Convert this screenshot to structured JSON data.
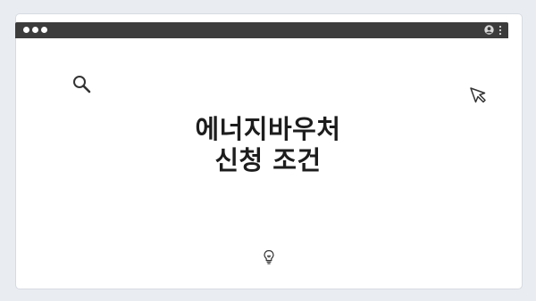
{
  "browser": {
    "window_controls": [
      "close",
      "minimize",
      "maximize"
    ],
    "toolbar_icons": [
      "user-icon",
      "menu-dots-icon"
    ]
  },
  "slide": {
    "title_line1": "에너지바우처",
    "title_line2": "신청 조건",
    "icons": [
      "search-icon",
      "cursor-icon",
      "lightbulb-icon"
    ]
  },
  "colors": {
    "background": "#e9edf2",
    "titlebar": "#3c3c3c",
    "content": "#ffffff",
    "text": "#1d1d1d",
    "icon_stroke": "#333333"
  }
}
